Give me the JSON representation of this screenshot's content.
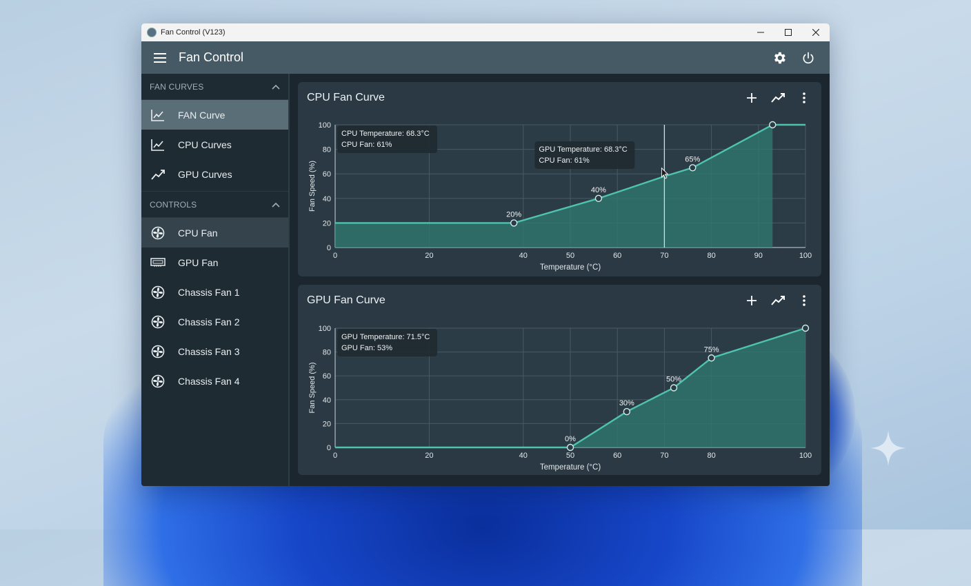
{
  "window": {
    "title": "Fan Control (V123)"
  },
  "app": {
    "title": "Fan Control"
  },
  "sidebar": {
    "fan_curves": {
      "header": "FAN CURVES",
      "items": [
        {
          "label": "FAN Curve",
          "icon": "chart-line-icon"
        },
        {
          "label": "CPU Curves",
          "icon": "chart-line-icon"
        },
        {
          "label": "GPU Curves",
          "icon": "trending-up-icon"
        }
      ]
    },
    "controls": {
      "header": "CONTROLS",
      "items": [
        {
          "label": "CPU Fan",
          "icon": "fan-icon"
        },
        {
          "label": "GPU Fan",
          "icon": "gpu-card-icon"
        },
        {
          "label": "Chassis Fan 1",
          "icon": "fan-icon"
        },
        {
          "label": "Chassis Fan 2",
          "icon": "fan-icon"
        },
        {
          "label": "Chassis Fan 3",
          "icon": "fan-icon"
        },
        {
          "label": "Chassis Fan 4",
          "icon": "fan-icon"
        }
      ]
    }
  },
  "colors": {
    "accent": "#4fc3b0",
    "fill": "#2f7a72",
    "panel": "#2a3943"
  },
  "chart_data": [
    {
      "type": "line",
      "title": "CPU Fan Curve",
      "xlabel": "Temperature (°C)",
      "ylabel": "Fan Speed (%)",
      "xlim": [
        0,
        100
      ],
      "ylim": [
        0,
        100
      ],
      "xticks": [
        0,
        20,
        40,
        50,
        60,
        70,
        80,
        90,
        100
      ],
      "yticks": [
        0,
        20,
        40,
        60,
        80,
        100
      ],
      "grid": true,
      "series": [
        {
          "points": [
            [
              0,
              20
            ],
            [
              38,
              20
            ],
            [
              56,
              40
            ],
            [
              70,
              58
            ],
            [
              76,
              65
            ],
            [
              93,
              100
            ],
            [
              100,
              100
            ]
          ],
          "fill_to": 93
        }
      ],
      "markers": [
        [
          38,
          20
        ],
        [
          56,
          40
        ],
        [
          76,
          65
        ],
        [
          93,
          100
        ]
      ],
      "point_labels": [
        {
          "x": 38,
          "y": 20,
          "text": "20%"
        },
        {
          "x": 56,
          "y": 40,
          "text": "40%"
        },
        {
          "x": 76,
          "y": 65,
          "text": "65%"
        }
      ],
      "cursor_x": 70,
      "tooltips": [
        {
          "lines": [
            "CPU Temperature: 68.3°C",
            "CPU Fan: 61%"
          ],
          "anchor": "top-left"
        },
        {
          "lines": [
            "GPU Temperature: 68.3°C",
            "CPU Fan: 61%"
          ],
          "anchor": "cursor"
        }
      ]
    },
    {
      "type": "line",
      "title": "GPU Fan Curve",
      "xlabel": "Temperature (°C)",
      "ylabel": "Fan Speed (%)",
      "xlim": [
        0,
        100
      ],
      "ylim": [
        0,
        100
      ],
      "xticks": [
        0,
        20,
        40,
        50,
        60,
        70,
        80,
        100
      ],
      "yticks": [
        0,
        20,
        40,
        60,
        80,
        100
      ],
      "grid": true,
      "series": [
        {
          "points": [
            [
              0,
              0
            ],
            [
              50,
              0
            ],
            [
              62,
              30
            ],
            [
              72,
              50
            ],
            [
              80,
              75
            ],
            [
              100,
              100
            ]
          ],
          "fill_to": 100
        }
      ],
      "markers": [
        [
          50,
          0
        ],
        [
          62,
          30
        ],
        [
          72,
          50
        ],
        [
          80,
          75
        ],
        [
          100,
          100
        ]
      ],
      "point_labels": [
        {
          "x": 50,
          "y": 0,
          "text": "0%"
        },
        {
          "x": 62,
          "y": 30,
          "text": "30%"
        },
        {
          "x": 72,
          "y": 50,
          "text": "50%"
        },
        {
          "x": 80,
          "y": 75,
          "text": "75%"
        }
      ],
      "tooltips": [
        {
          "lines": [
            "GPU Temperature: 71.5°C",
            "GPU Fan: 53%"
          ],
          "anchor": "top-left"
        }
      ]
    }
  ]
}
